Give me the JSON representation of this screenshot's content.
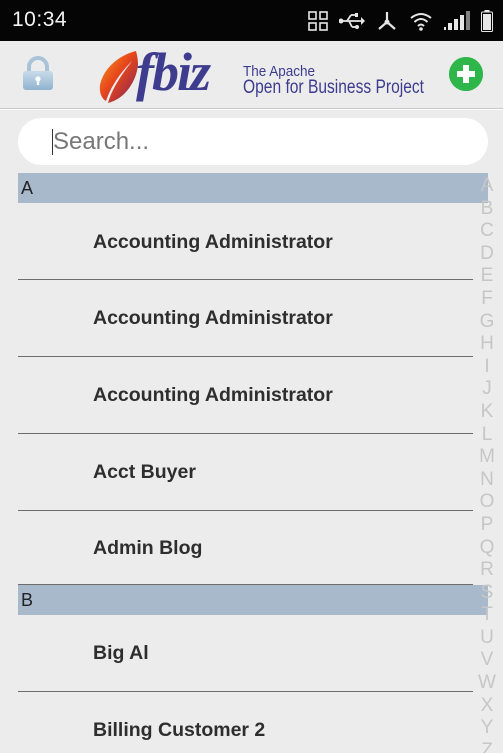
{
  "status_bar": {
    "time": "10:34",
    "icons": [
      "grid-icon",
      "usb-icon",
      "share-icon",
      "wifi-icon",
      "signal-icon",
      "battery-icon"
    ]
  },
  "header": {
    "logo": {
      "wordmark": "fbiz",
      "tagline_line1": "The Apache",
      "tagline_line2": "Open for Business Project"
    },
    "left_icon": "lock-icon",
    "right_icon": "add-icon",
    "accent_color": "#2fb64a",
    "brand_color": "#3d3c8e"
  },
  "search": {
    "placeholder": "Search...",
    "value": ""
  },
  "list": {
    "sections": [
      {
        "letter": "A",
        "items": [
          "Accounting Administrator",
          "Accounting Administrator",
          "Accounting Administrator",
          "Acct Buyer",
          "Admin Blog"
        ]
      },
      {
        "letter": "B",
        "items": [
          "Big Al",
          "Billing Customer 2"
        ]
      }
    ]
  },
  "alphabet_index": [
    "A",
    "B",
    "C",
    "D",
    "E",
    "F",
    "G",
    "H",
    "I",
    "J",
    "K",
    "L",
    "M",
    "N",
    "O",
    "P",
    "Q",
    "R",
    "S",
    "T",
    "U",
    "V",
    "W",
    "X",
    "Y",
    "Z"
  ]
}
